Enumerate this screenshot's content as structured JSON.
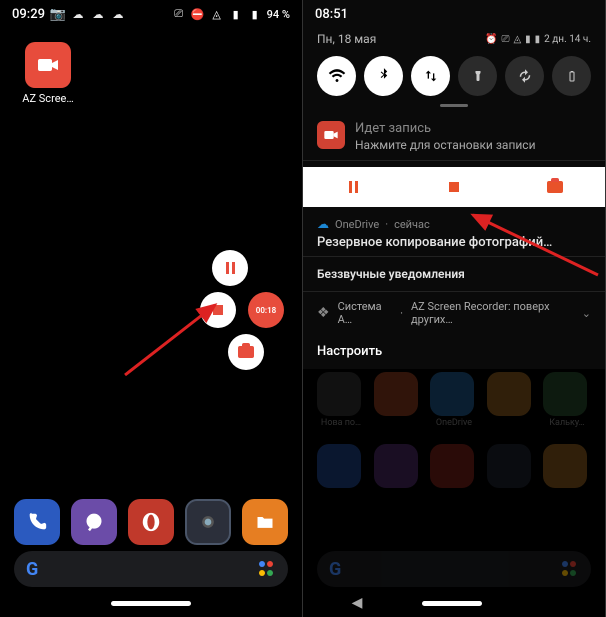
{
  "left": {
    "time": "09:29",
    "battery": "94 %",
    "app_label": "AZ Scree…",
    "rec_time": "00:18"
  },
  "right": {
    "time": "08:51",
    "date": "Пн, 18 мая",
    "battery_detail": "2 дн. 14 ч.",
    "rec_title": "Идет запись",
    "rec_sub": "Нажмите для остановки записи",
    "od_app": "OneDrive",
    "od_when": "сейчас",
    "od_body": "Резервное копирование фотографий…",
    "silent_header": "Беззвучные уведомления",
    "sys_app": "Система А…",
    "sys_text": "AZ Screen Recorder: поверх других…",
    "settings": "Настроить",
    "bg_labels": [
      "Нова по…",
      "OneDrive",
      "Кальку…"
    ]
  }
}
